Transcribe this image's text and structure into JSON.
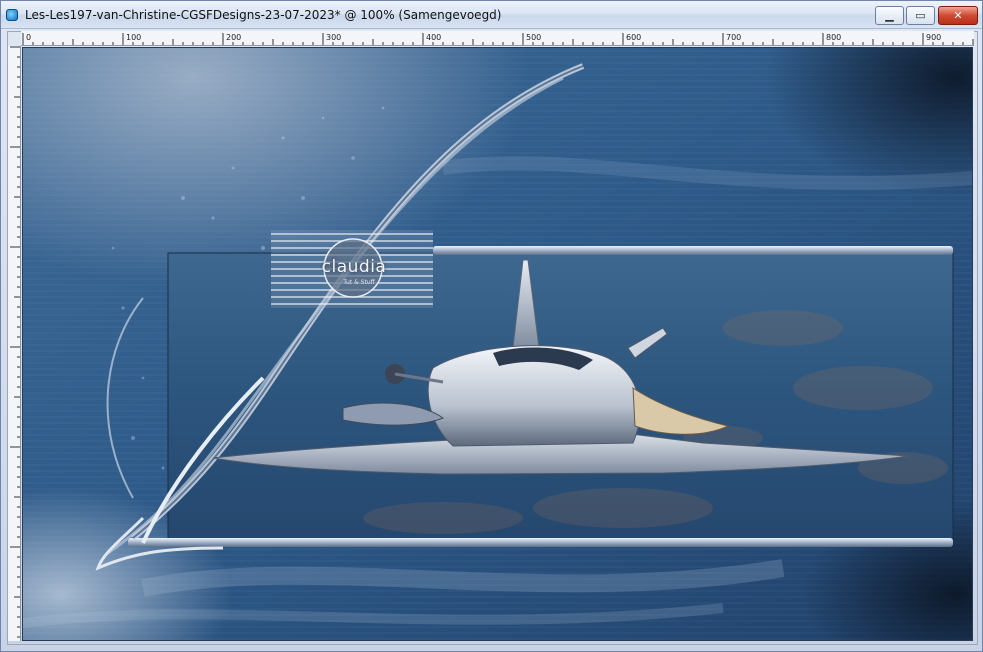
{
  "window": {
    "title": "Les-Les197-van-Christine-CGSFDesigns-23-07-2023* @ 100% (Samengevoegd)",
    "controls": {
      "minimize_icon": "minimize-icon",
      "maximize_icon": "maximize-icon",
      "close_icon": "close-icon",
      "minimize_glyph": "▁",
      "maximize_glyph": "▭",
      "close_glyph": "✕"
    }
  },
  "ruler": {
    "labels": [
      "0",
      "100",
      "200",
      "300",
      "400",
      "500",
      "600",
      "700",
      "800",
      "900"
    ]
  },
  "canvas": {
    "logo_text": "claudia",
    "logo_sub": "Tut & Stuff",
    "colors": {
      "background_dark": "#1d3a5e",
      "background_mid": "#3b6a9b",
      "accent_light": "#c8d6e8"
    }
  }
}
